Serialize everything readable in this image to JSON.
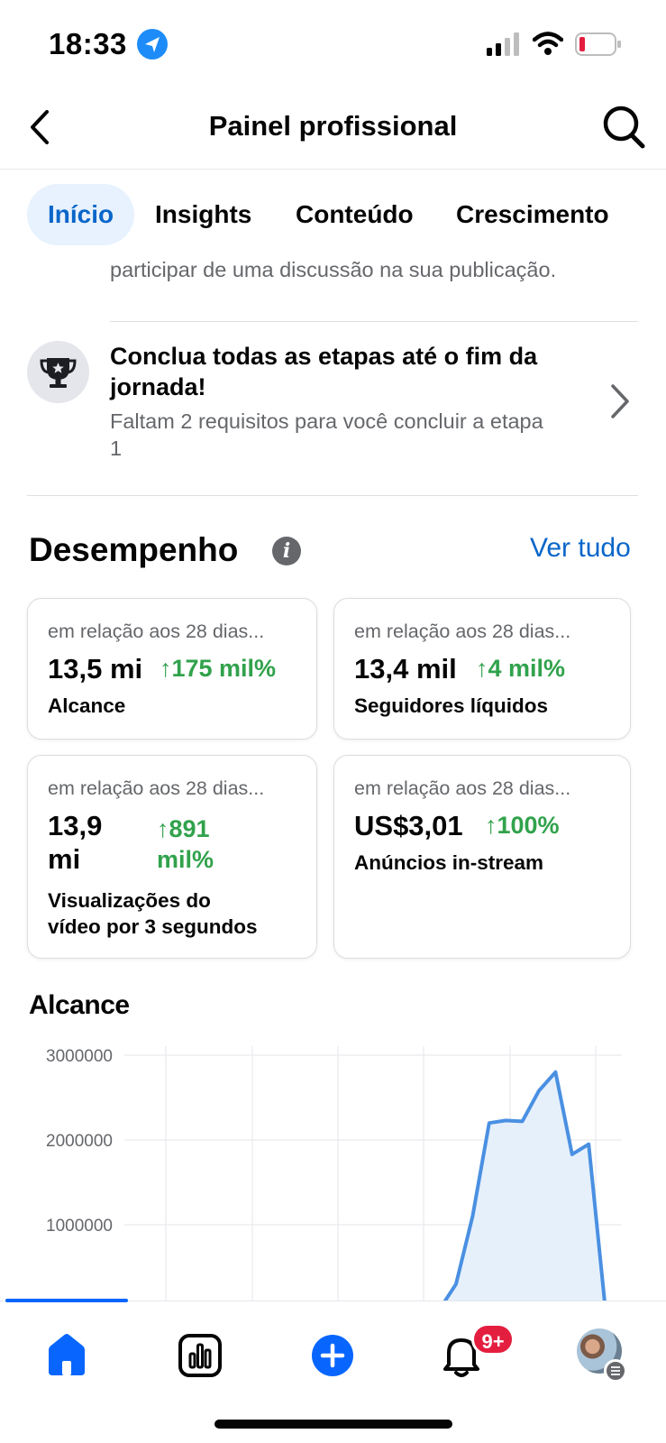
{
  "status_bar": {
    "time": "18:33"
  },
  "header": {
    "title": "Painel profissional"
  },
  "tabs": [
    {
      "label": "Início",
      "active": true
    },
    {
      "label": "Insights",
      "active": false
    },
    {
      "label": "Conteúdo",
      "active": false
    },
    {
      "label": "Crescimento",
      "active": false
    }
  ],
  "journey": {
    "prev_text": "participar de uma discussão na sua publicação.",
    "title": "Conclua todas as etapas até o fim da jornada!",
    "subtitle": "Faltam 2 requisitos para você concluir a etapa 1"
  },
  "performance": {
    "title": "Desempenho",
    "see_all": "Ver tudo",
    "cards": [
      {
        "caption": "em relação aos 28 dias...",
        "value": "13,5 mi",
        "delta": "↑175 mil%",
        "label": "Alcance"
      },
      {
        "caption": "em relação aos 28 dias...",
        "value": "13,4 mil",
        "delta": "↑4 mil%",
        "label": "Seguidores líquidos"
      },
      {
        "caption": "em relação aos 28 dias...",
        "value_line1": "13,9",
        "value_line2": "mi",
        "delta_line1": "↑891",
        "delta_line2": "mil%",
        "label_line1": "Visualizações do",
        "label_line2": "vídeo por 3 segundos"
      },
      {
        "caption": "em relação aos 28 dias...",
        "value": "US$3,01",
        "delta": "↑100%",
        "label": "Anúncios in-stream"
      }
    ]
  },
  "chart_data": {
    "type": "area",
    "title": "Alcance",
    "y_ticks": [
      "3000000",
      "2000000",
      "1000000",
      "0"
    ],
    "ylim": [
      0,
      3000000
    ],
    "grid": true,
    "color": "#4a90e2",
    "fill": "#e6f0fb",
    "x": [
      1,
      2,
      3,
      4,
      5,
      6,
      7,
      8,
      9,
      10,
      11,
      12,
      13,
      14,
      15,
      16,
      17,
      18,
      19,
      20,
      21,
      22,
      23,
      24,
      25,
      26,
      27,
      28,
      29,
      30,
      31
    ],
    "values": [
      0,
      0,
      0,
      0,
      0,
      0,
      0,
      0,
      0,
      0,
      0,
      0,
      0,
      0,
      0,
      0,
      0,
      0,
      0,
      0,
      300000,
      1100000,
      2200000,
      2230000,
      2220000,
      2580000,
      2800000,
      1830000,
      1950000,
      20000,
      0
    ]
  },
  "bottom_nav": {
    "items": [
      "home-icon",
      "insights-icon",
      "create-icon",
      "notifications-icon",
      "profile-avatar"
    ],
    "notification_badge": "9+",
    "accent": "#0866ff"
  }
}
